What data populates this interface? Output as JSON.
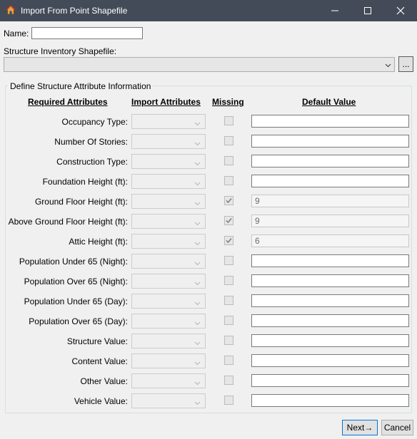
{
  "window": {
    "title": "Import From Point Shapefile",
    "icon": "house-icon",
    "controls": [
      "minimize-icon",
      "maximize-icon",
      "close-icon"
    ]
  },
  "form": {
    "name_label": "Name:",
    "name_value": "",
    "shapefile_label": "Structure Inventory Shapefile:",
    "shapefile_value": "",
    "browse_label": "...",
    "group_title": "Define Structure Attribute Information"
  },
  "columns": {
    "required": "Required Attributes",
    "import": "Import Attributes",
    "missing": "Missing",
    "default": "Default Value"
  },
  "rows": [
    {
      "label": "Occupancy Type:",
      "missing": false,
      "default": ""
    },
    {
      "label": "Number Of Stories:",
      "missing": false,
      "default": ""
    },
    {
      "label": "Construction Type:",
      "missing": false,
      "default": ""
    },
    {
      "label": "Foundation Height (ft):",
      "missing": false,
      "default": ""
    },
    {
      "label": "Ground Floor Height (ft):",
      "missing": true,
      "default": "9"
    },
    {
      "label": "Above Ground Floor Height (ft):",
      "missing": true,
      "default": "9"
    },
    {
      "label": "Attic Height (ft):",
      "missing": true,
      "default": "6"
    },
    {
      "label": "Population Under 65 (Night):",
      "missing": false,
      "default": ""
    },
    {
      "label": "Population Over 65 (Night):",
      "missing": false,
      "default": ""
    },
    {
      "label": "Population Under 65 (Day):",
      "missing": false,
      "default": ""
    },
    {
      "label": "Population Over 65 (Day):",
      "missing": false,
      "default": ""
    },
    {
      "label": "Structure Value:",
      "missing": false,
      "default": ""
    },
    {
      "label": "Content Value:",
      "missing": false,
      "default": ""
    },
    {
      "label": "Other Value:",
      "missing": false,
      "default": ""
    },
    {
      "label": "Vehicle Value:",
      "missing": false,
      "default": ""
    }
  ],
  "footer": {
    "next_label": "Next→",
    "cancel_label": "Cancel"
  }
}
